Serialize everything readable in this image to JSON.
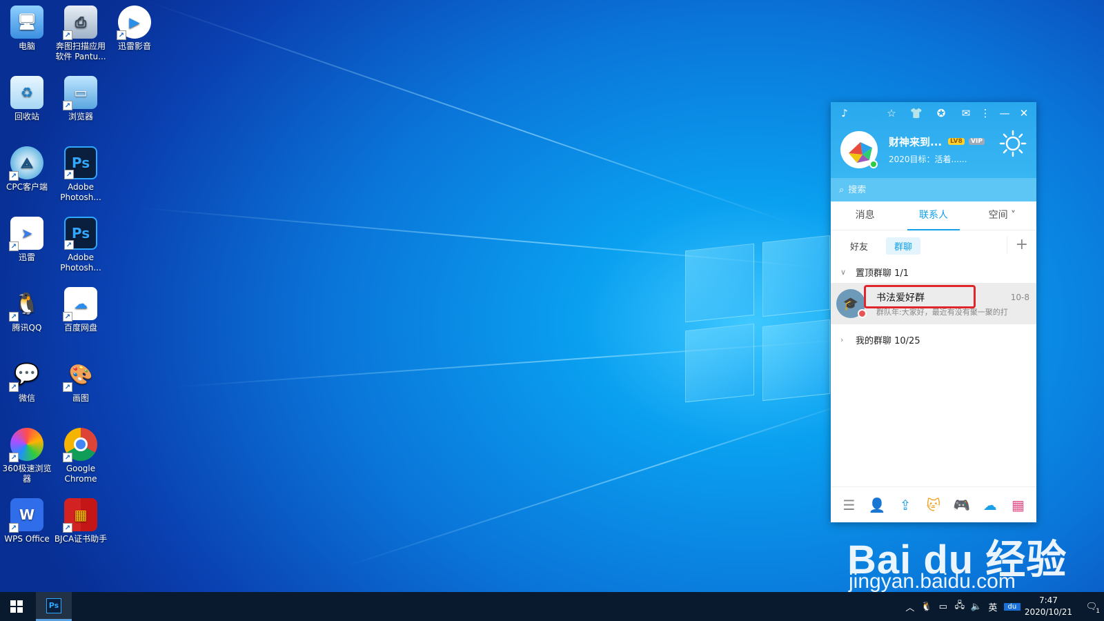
{
  "desktop": {
    "icons": [
      {
        "label": "电脑",
        "icon": "computer-icon"
      },
      {
        "label": "奔图扫描应用软件 Pantu...",
        "icon": "scanner-icon"
      },
      {
        "label": "迅雷影音",
        "icon": "xunlei-player-icon"
      },
      {
        "label": "回收站",
        "icon": "recycle-bin-icon"
      },
      {
        "label": "浏览器",
        "icon": "browser-icon"
      },
      {
        "label": "CPC客户端",
        "icon": "cpc-client-icon"
      },
      {
        "label": "Adobe Photosh...",
        "icon": "photoshop-icon"
      },
      {
        "label": "迅雷",
        "icon": "xunlei-icon"
      },
      {
        "label": "Adobe Photosh...",
        "icon": "photoshop-icon"
      },
      {
        "label": "腾讯QQ",
        "icon": "qq-icon"
      },
      {
        "label": "百度网盘",
        "icon": "baidu-netdisk-icon"
      },
      {
        "label": "微信",
        "icon": "wechat-icon"
      },
      {
        "label": "画图",
        "icon": "paint-icon"
      },
      {
        "label": "360极速浏览器",
        "icon": "360-browser-icon"
      },
      {
        "label": "Google Chrome",
        "icon": "chrome-icon"
      },
      {
        "label": "WPS Office",
        "icon": "wps-icon"
      },
      {
        "label": "BJCA证书助手",
        "icon": "bjca-icon"
      }
    ]
  },
  "qq": {
    "profile": {
      "nickname": "财神来到...",
      "level_badge": "LV8",
      "vip_badge": "VIP",
      "signature": "2020目标：活着......"
    },
    "search": {
      "placeholder": "搜索"
    },
    "tabs": [
      {
        "label": "消息",
        "active": false
      },
      {
        "label": "联系人",
        "active": true
      },
      {
        "label": "空间 ˅",
        "active": false
      }
    ],
    "subtabs": [
      {
        "label": "好友",
        "active": false
      },
      {
        "label": "群聊",
        "active": true
      }
    ],
    "groups": {
      "pinned": {
        "label": "置顶群聊 1/1"
      },
      "pinned_item": {
        "name": "书法爱好群",
        "time": "10-8",
        "preview": "群队年:大家好，最近有没有聚一聚的打"
      },
      "mine": {
        "label": "我的群聊 10/25"
      }
    }
  },
  "watermark": {
    "brand": "Bai du 经验",
    "url": "jingyan.baidu.com"
  },
  "taskbar": {
    "ime": "英",
    "time": "7:47",
    "date": "2020/10/21",
    "notification_count": "1"
  }
}
